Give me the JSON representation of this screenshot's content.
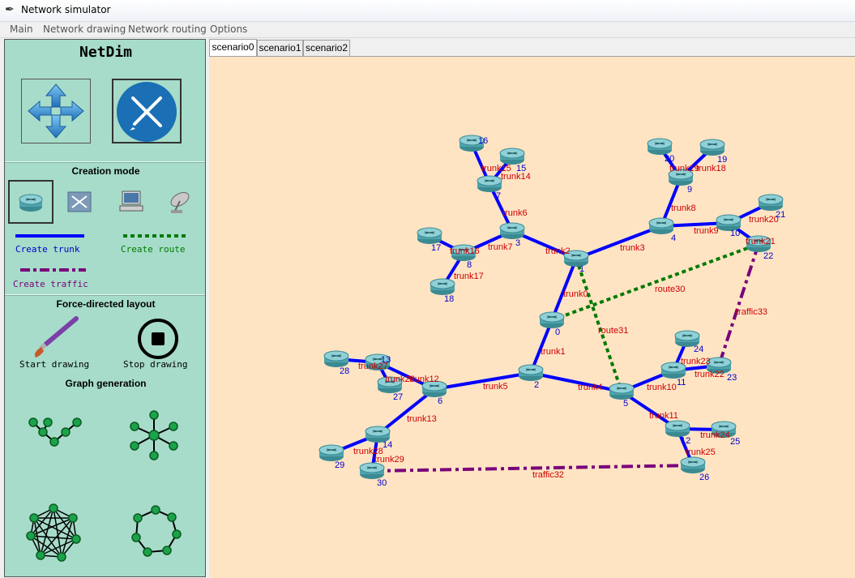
{
  "window": {
    "title": "Network simulator"
  },
  "menu": [
    "Main",
    "Network drawing",
    "Network routing",
    "Options"
  ],
  "panel": {
    "title": "NetDim",
    "creation_mode": "Creation mode",
    "create_trunk": "Create trunk",
    "create_route": "Create route",
    "create_traffic": "Create traffic",
    "force_directed": "Force-directed layout",
    "start_drawing": "Start drawing",
    "stop_drawing": "Stop drawing",
    "graph_generation": "Graph generation"
  },
  "tabs": [
    {
      "label": "scenario0",
      "active": true
    },
    {
      "label": "scenario1",
      "active": false
    },
    {
      "label": "scenario2",
      "active": false
    }
  ],
  "colors": {
    "canvas_bg": "#ffe4c4",
    "panel_bg": "#a6dcc9",
    "trunk": "#0000ff",
    "route": "#007a00",
    "traffic": "#7a007a",
    "node_label": "#0000cc",
    "link_label": "#cc0000"
  },
  "nodes": [
    "0",
    "1",
    "2",
    "3",
    "4",
    "5",
    "6",
    "7",
    "8",
    "9",
    "10",
    "11",
    "12",
    "13",
    "14",
    "15",
    "16",
    "17",
    "18",
    "19",
    "20",
    "21",
    "22",
    "23",
    "24",
    "25",
    "26",
    "27",
    "28",
    "29",
    "30"
  ],
  "trunks": [
    {
      "a": "0",
      "b": "1",
      "label": "trunk0"
    },
    {
      "a": "0",
      "b": "2",
      "label": "trunk1"
    },
    {
      "a": "1",
      "b": "3",
      "label": "trunk2"
    },
    {
      "a": "1",
      "b": "4",
      "label": "trunk3"
    },
    {
      "a": "2",
      "b": "5",
      "label": "trunk4"
    },
    {
      "a": "2",
      "b": "6",
      "label": "trunk5"
    },
    {
      "a": "3",
      "b": "7",
      "label": "trunk6"
    },
    {
      "a": "3",
      "b": "8",
      "label": "trunk7"
    },
    {
      "a": "4",
      "b": "9",
      "label": "trunk8"
    },
    {
      "a": "4",
      "b": "10",
      "label": "trunk9"
    },
    {
      "a": "5",
      "b": "11",
      "label": "trunk10"
    },
    {
      "a": "5",
      "b": "12",
      "label": "trunk11"
    },
    {
      "a": "6",
      "b": "13",
      "label": "trunk12"
    },
    {
      "a": "6",
      "b": "14",
      "label": "trunk13"
    },
    {
      "a": "7",
      "b": "15",
      "label": "trunk14"
    },
    {
      "a": "7",
      "b": "16",
      "label": "trunk15"
    },
    {
      "a": "8",
      "b": "17",
      "label": "trunk16"
    },
    {
      "a": "8",
      "b": "18",
      "label": "trunk17"
    },
    {
      "a": "9",
      "b": "19",
      "label": "trunk18"
    },
    {
      "a": "9",
      "b": "20",
      "label": "trunk19"
    },
    {
      "a": "10",
      "b": "21",
      "label": "trunk20"
    },
    {
      "a": "10",
      "b": "22",
      "label": "trunk21"
    },
    {
      "a": "11",
      "b": "23",
      "label": "trunk22"
    },
    {
      "a": "11",
      "b": "24",
      "label": "trunk23"
    },
    {
      "a": "12",
      "b": "25",
      "label": "trunk24"
    },
    {
      "a": "12",
      "b": "26",
      "label": "trunk25"
    },
    {
      "a": "13",
      "b": "27",
      "label": "trunk26"
    },
    {
      "a": "13",
      "b": "28",
      "label": "trunk27"
    },
    {
      "a": "14",
      "b": "29",
      "label": "trunk28"
    },
    {
      "a": "14",
      "b": "30",
      "label": "trunk29"
    }
  ],
  "routes": [
    {
      "a": "0",
      "b": "22",
      "label": "route30"
    },
    {
      "a": "1",
      "b": "5",
      "label": "route31"
    }
  ],
  "traffics": [
    {
      "a": "30",
      "b": "26",
      "label": "traffic32"
    },
    {
      "a": "22",
      "b": "23",
      "label": "traffic33"
    }
  ]
}
